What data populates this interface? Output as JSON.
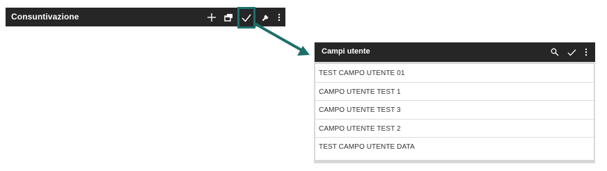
{
  "toolbar": {
    "title": "Consuntivazione",
    "icons": [
      "add-icon",
      "window-icon",
      "check-icon",
      "wrench-icon",
      "more-vert-icon"
    ]
  },
  "panel": {
    "title": "Campi utente",
    "icons": [
      "search-icon",
      "check-icon",
      "more-vert-icon"
    ],
    "items": [
      {
        "label": "TEST CAMPO UTENTE 01"
      },
      {
        "label": "CAMPO UTENTE TEST 1"
      },
      {
        "label": "CAMPO UTENTE TEST 3"
      },
      {
        "label": "CAMPO UTENTE TEST 2"
      },
      {
        "label": "TEST CAMPO UTENTE DATA"
      }
    ]
  },
  "colors": {
    "bar": "#262626",
    "highlight": "#1d6f6a",
    "panel_border": "#d7d9d9"
  }
}
